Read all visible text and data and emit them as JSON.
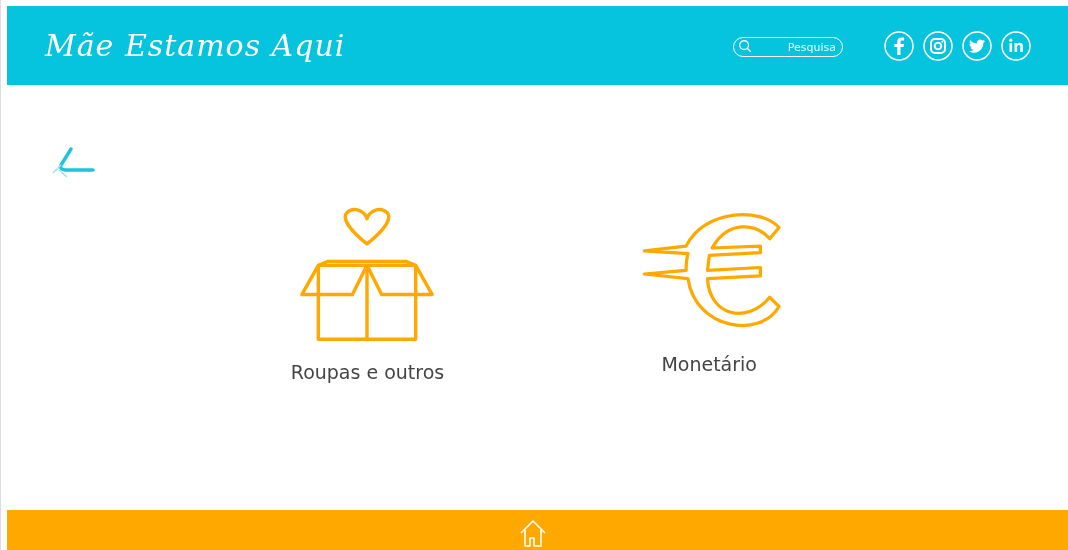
{
  "header": {
    "logo": "Mãe Estamos Aqui",
    "search": {
      "placeholder": "Pesquisa"
    },
    "social": [
      {
        "kind": "facebook"
      },
      {
        "kind": "instagram"
      },
      {
        "kind": "twitter"
      },
      {
        "kind": "linkedin"
      }
    ]
  },
  "options": [
    {
      "kind": "goods",
      "label": "Roupas e outros"
    },
    {
      "kind": "money",
      "label": "Monetário"
    }
  ]
}
